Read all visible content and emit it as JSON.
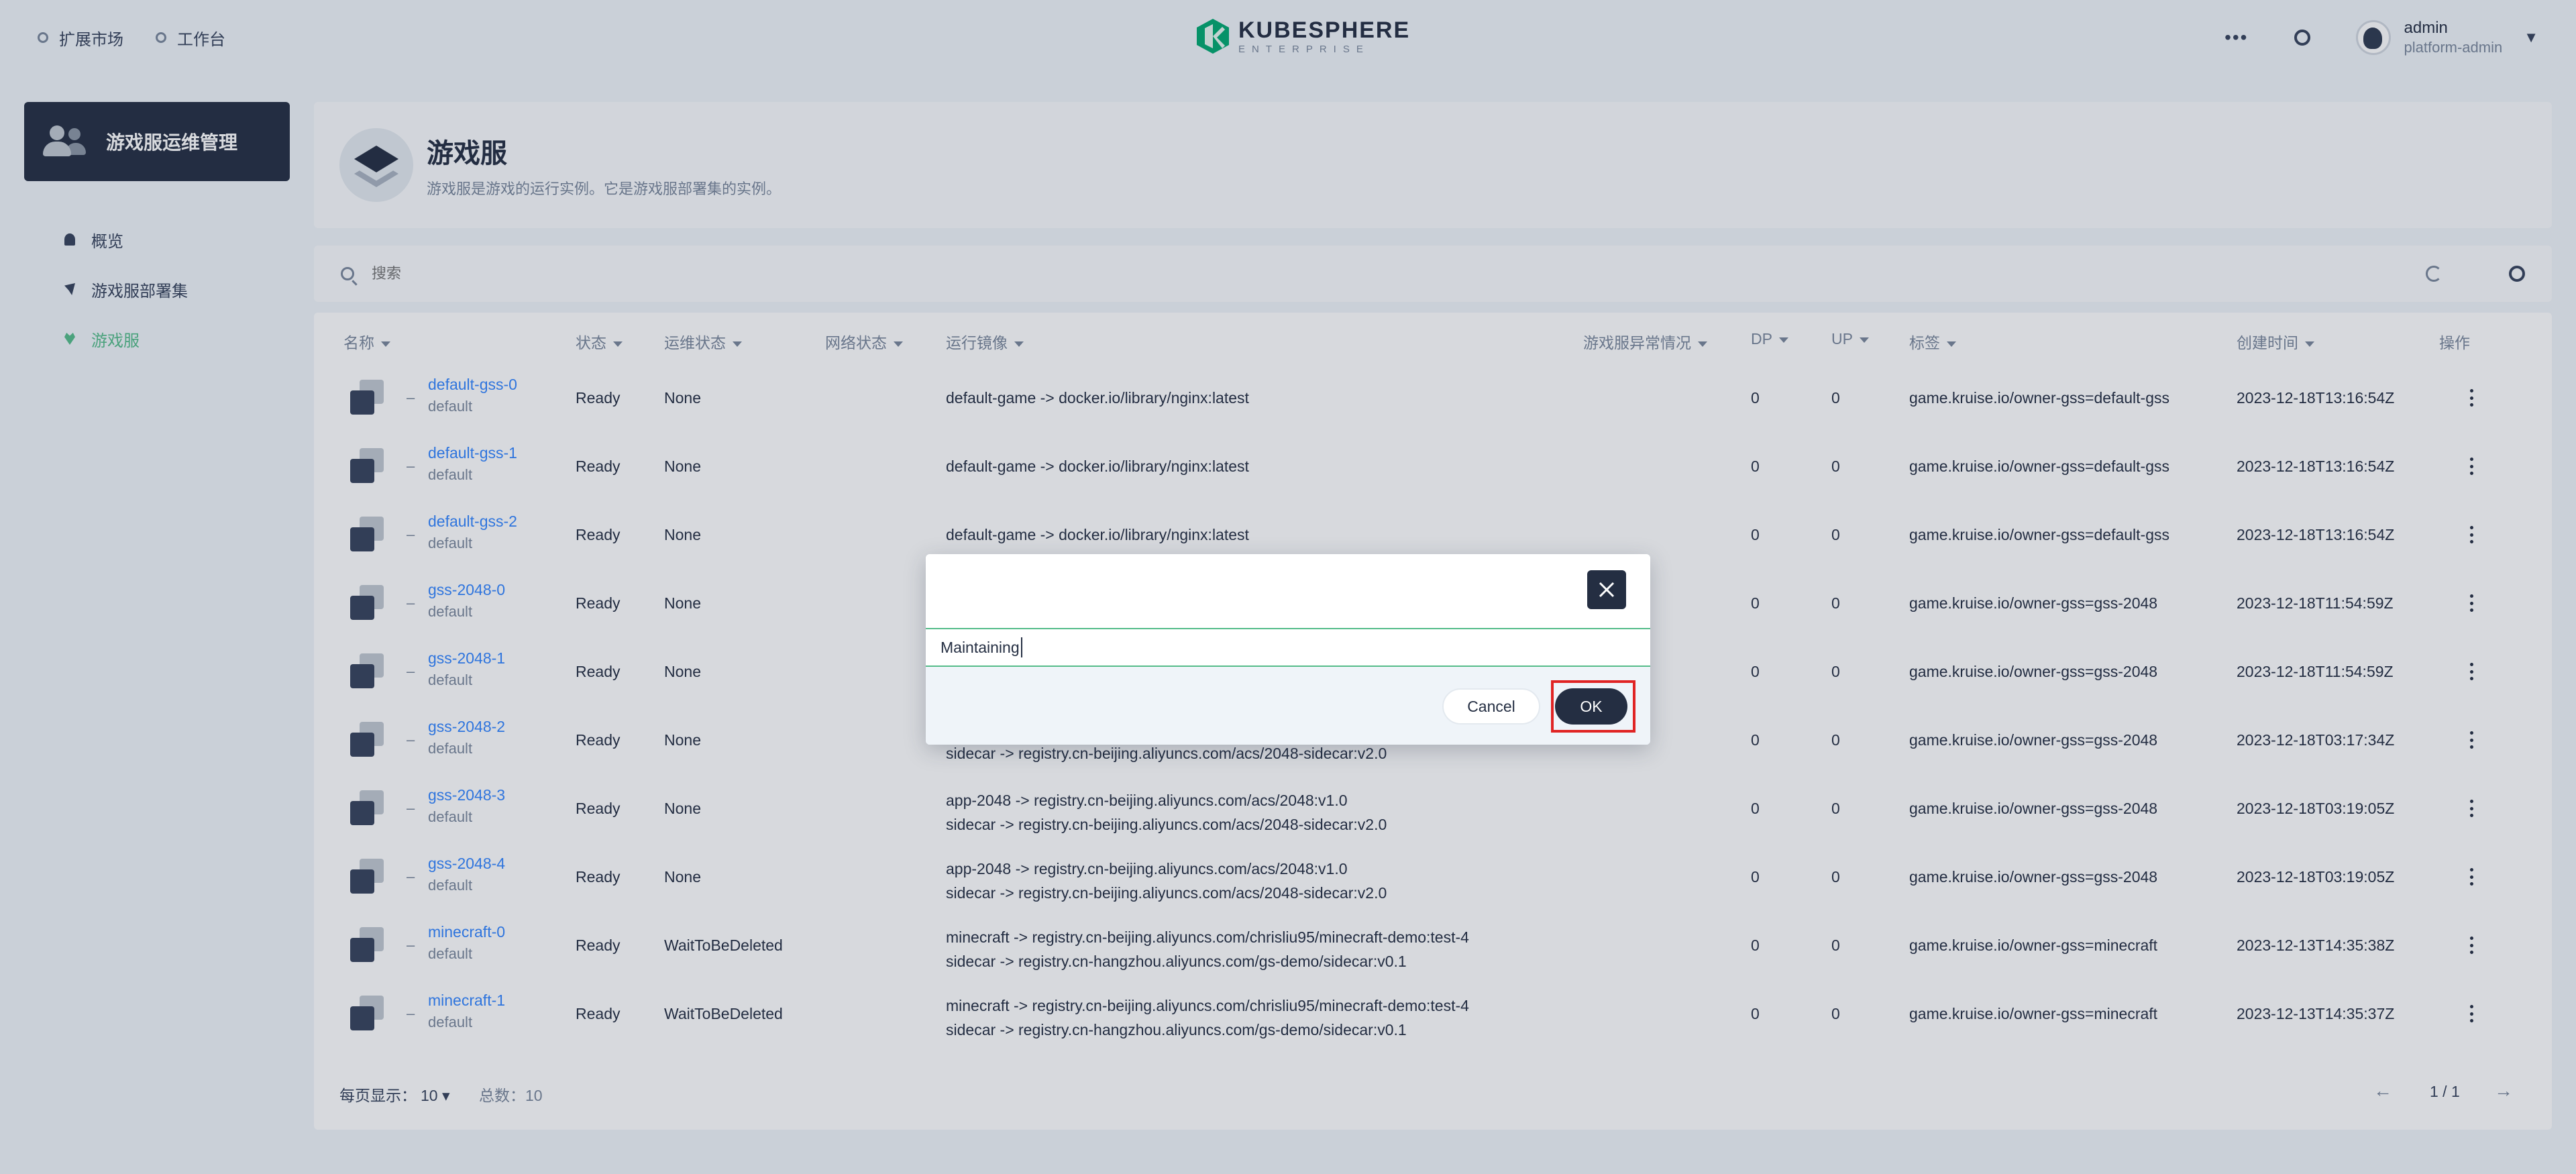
{
  "topbar": {
    "nav": [
      {
        "label": "扩展市场",
        "icon": "extension-icon"
      },
      {
        "label": "工作台",
        "icon": "workbench-icon"
      }
    ],
    "logo_title": "KUBESPHERE",
    "logo_sub": "ENTERPRISE",
    "more_icon": "more-icon",
    "user_name": "admin",
    "user_role": "platform-admin"
  },
  "sidebar": {
    "title": "游戏服运维管理",
    "items": [
      {
        "label": "概览",
        "active": false
      },
      {
        "label": "游戏服部署集",
        "active": false
      },
      {
        "label": "游戏服",
        "active": true
      }
    ]
  },
  "page": {
    "title": "游戏服",
    "description": "游戏服是游戏的运行实例。它是游戏服部署集的实例。"
  },
  "toolbar": {
    "search_placeholder": "搜索"
  },
  "table": {
    "headers": {
      "name": "名称",
      "status": "状态",
      "ops_status": "运维状态",
      "network_status": "网络状态",
      "images": "运行镜像",
      "anomaly": "游戏服异常情况",
      "dp": "DP",
      "up": "UP",
      "labels": "标签",
      "created": "创建时间",
      "actions": "操作"
    },
    "rows": [
      {
        "name": "default-gss-0",
        "ns": "default",
        "status": "Ready",
        "ops": "None",
        "img1": "default-game -> docker.io/library/nginx:latest",
        "img2": "",
        "dp": "0",
        "up": "0",
        "label": "game.kruise.io/owner-gss=default-gss",
        "created": "2023-12-18T13:16:54Z"
      },
      {
        "name": "default-gss-1",
        "ns": "default",
        "status": "Ready",
        "ops": "None",
        "img1": "default-game -> docker.io/library/nginx:latest",
        "img2": "",
        "dp": "0",
        "up": "0",
        "label": "game.kruise.io/owner-gss=default-gss",
        "created": "2023-12-18T13:16:54Z"
      },
      {
        "name": "default-gss-2",
        "ns": "default",
        "status": "Ready",
        "ops": "None",
        "img1": "default-game -> docker.io/library/nginx:latest",
        "img2": "",
        "dp": "0",
        "up": "0",
        "label": "game.kruise.io/owner-gss=default-gss",
        "created": "2023-12-18T13:16:54Z"
      },
      {
        "name": "gss-2048-0",
        "ns": "default",
        "status": "Ready",
        "ops": "None",
        "img1": "",
        "img2": "",
        "dp": "0",
        "up": "0",
        "label": "game.kruise.io/owner-gss=gss-2048",
        "created": "2023-12-18T11:54:59Z"
      },
      {
        "name": "gss-2048-1",
        "ns": "default",
        "status": "Ready",
        "ops": "None",
        "img1": "",
        "img2": "",
        "dp": "0",
        "up": "0",
        "label": "game.kruise.io/owner-gss=gss-2048",
        "created": "2023-12-18T11:54:59Z"
      },
      {
        "name": "gss-2048-2",
        "ns": "default",
        "status": "Ready",
        "ops": "None",
        "img1": "",
        "img2": "sidecar -> registry.cn-beijing.aliyuncs.com/acs/2048-sidecar:v2.0",
        "dp": "0",
        "up": "0",
        "label": "game.kruise.io/owner-gss=gss-2048",
        "created": "2023-12-18T03:17:34Z"
      },
      {
        "name": "gss-2048-3",
        "ns": "default",
        "status": "Ready",
        "ops": "None",
        "img1": "app-2048 -> registry.cn-beijing.aliyuncs.com/acs/2048:v1.0",
        "img2": "sidecar -> registry.cn-beijing.aliyuncs.com/acs/2048-sidecar:v2.0",
        "dp": "0",
        "up": "0",
        "label": "game.kruise.io/owner-gss=gss-2048",
        "created": "2023-12-18T03:19:05Z"
      },
      {
        "name": "gss-2048-4",
        "ns": "default",
        "status": "Ready",
        "ops": "None",
        "img1": "app-2048 -> registry.cn-beijing.aliyuncs.com/acs/2048:v1.0",
        "img2": "sidecar -> registry.cn-beijing.aliyuncs.com/acs/2048-sidecar:v2.0",
        "dp": "0",
        "up": "0",
        "label": "game.kruise.io/owner-gss=gss-2048",
        "created": "2023-12-18T03:19:05Z"
      },
      {
        "name": "minecraft-0",
        "ns": "default",
        "status": "Ready",
        "ops": "WaitToBeDeleted",
        "img1": "minecraft -> registry.cn-beijing.aliyuncs.com/chrisliu95/minecraft-demo:test-4",
        "img2": "sidecar -> registry.cn-hangzhou.aliyuncs.com/gs-demo/sidecar:v0.1",
        "dp": "0",
        "up": "0",
        "label": "game.kruise.io/owner-gss=minecraft",
        "created": "2023-12-13T14:35:38Z"
      },
      {
        "name": "minecraft-1",
        "ns": "default",
        "status": "Ready",
        "ops": "WaitToBeDeleted",
        "img1": "minecraft -> registry.cn-beijing.aliyuncs.com/chrisliu95/minecraft-demo:test-4",
        "img2": "sidecar -> registry.cn-hangzhou.aliyuncs.com/gs-demo/sidecar:v0.1",
        "dp": "0",
        "up": "0",
        "label": "game.kruise.io/owner-gss=minecraft",
        "created": "2023-12-13T14:35:37Z"
      }
    ]
  },
  "pagination": {
    "page_size_label": "每页显示：",
    "page_size": "10",
    "total_label": "总数：10",
    "page_indicator": "1 / 1"
  },
  "modal": {
    "input_value": "Maintaining",
    "cancel_label": "Cancel",
    "ok_label": "OK",
    "highlight_color": "#e02424"
  }
}
